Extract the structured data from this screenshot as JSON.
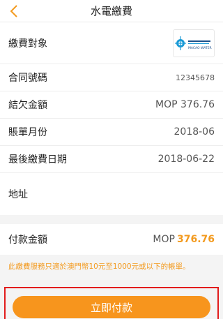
{
  "header": {
    "title": "水電繳費"
  },
  "rows": {
    "target_label": "繳費對象",
    "contract_label": "合同號碼",
    "contract_value": "12345678",
    "arrears_label": "結欠金額",
    "arrears_value": "MOP 376.76",
    "bill_month_label": "賬單月份",
    "bill_month_value": "2018-06",
    "last_date_label": "最後繳費日期",
    "last_date_value": "2018-06-22",
    "address_label": "地址"
  },
  "payment": {
    "label": "付款金額",
    "currency": "MOP",
    "amount": "376.76"
  },
  "notice": "此繳費服務只適於澳門幣10元至1000元或以下的帳單。",
  "button": {
    "label": "立即付款"
  },
  "colors": {
    "accent": "#f7951d",
    "highlight_border": "#e21b1b"
  },
  "logo": {
    "name": "macao-water-logo",
    "text": "MACAO WATER"
  }
}
